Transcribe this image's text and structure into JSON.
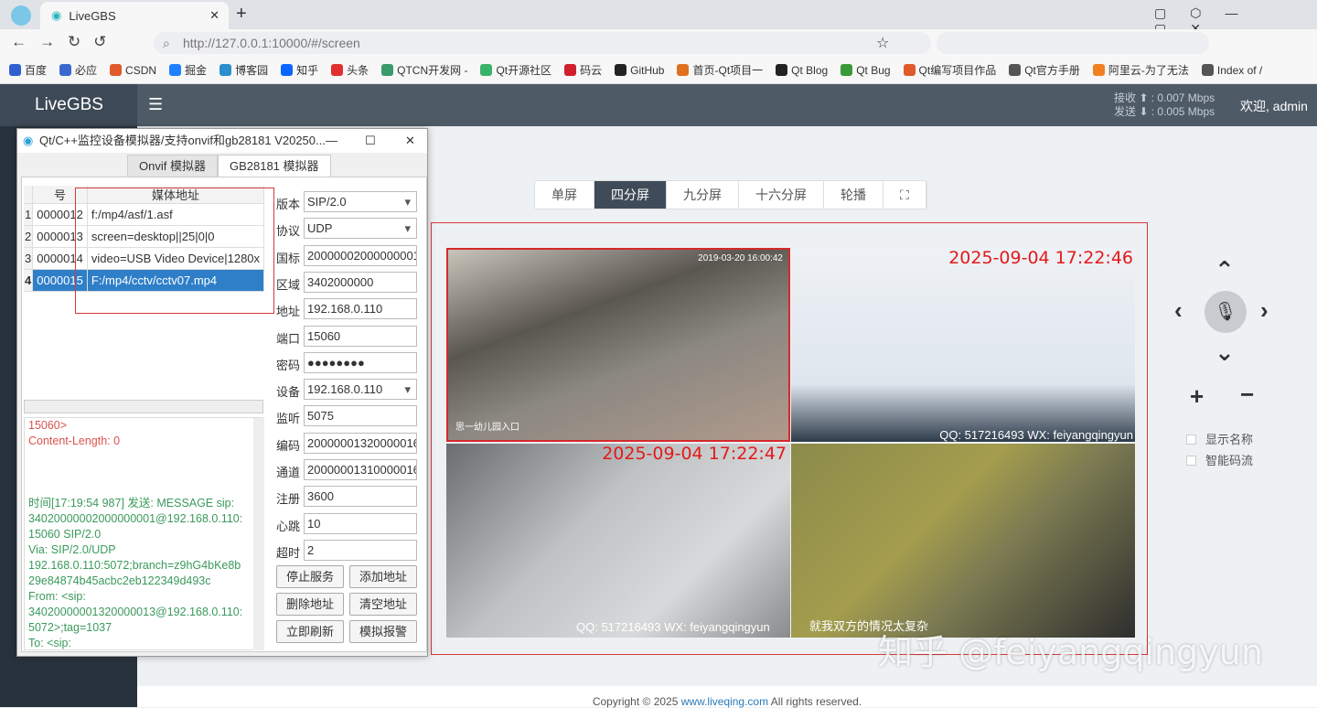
{
  "browser": {
    "tab_title": "LiveGBS",
    "url": "http://127.0.0.1:10000/#/screen",
    "bookmarks": [
      "百度",
      "必应",
      "CSDN",
      "掘金",
      "博客园",
      "知乎",
      "头条",
      "QTCN开发网 -",
      "Qt开源社区",
      "码云",
      "GitHub",
      "首页-Qt项目一",
      "Qt Blog",
      "Qt Bug",
      "Qt编写项目作品",
      "Qt官方手册",
      "阿里云-为了无法",
      "Index of /"
    ]
  },
  "app": {
    "logo": "LiveGBS",
    "recv_label": "接收",
    "recv_rate": "0.007 Mbps",
    "send_label": "发送",
    "send_rate": "0.005 Mbps",
    "welcome": "欢迎, admin",
    "layout_tabs": [
      "单屏",
      "四分屏",
      "九分屏",
      "十六分屏",
      "轮播"
    ],
    "active_layout": "四分屏",
    "tiles": [
      {
        "timestamp": "2019-03-20 16:00:42",
        "caption": "思一幼儿园入口"
      },
      {
        "timestamp": "2025-09-04 17:22:46",
        "qq": "QQ: 517216493  WX: feiyangqingyun"
      },
      {
        "timestamp": "2025-09-04 17:22:47"
      },
      {
        "qq": "QQ: 517216493  WX: feiyangqingyun",
        "subtitle": "就我双方的情况太复杂"
      }
    ],
    "options": [
      "显示名称",
      "智能码流"
    ],
    "watermark": "知乎 @feiyangqingyun",
    "footer": {
      "prefix": "Copyright © 2025 ",
      "link": "www.liveqing.com",
      "suffix": " All rights reserved."
    }
  },
  "qt": {
    "title": "Qt/C++监控设备模拟器/支持onvif和gb28181 V20250...",
    "tabs": [
      "Onvif 模拟器",
      "GB28181 模拟器"
    ],
    "table": {
      "headers": [
        "号",
        "媒体地址"
      ],
      "rows": [
        [
          "1",
          "0000012",
          "f:/mp4/asf/1.asf"
        ],
        [
          "2",
          "0000013",
          "screen=desktop||25|0|0"
        ],
        [
          "3",
          "0000014",
          "video=USB Video Device|1280x"
        ],
        [
          "4",
          "0000015",
          "F:/mp4/cctv/cctv07.mp4"
        ]
      ]
    },
    "log": [
      {
        "t": "15060>",
        "c": "#d9534f"
      },
      {
        "t": "Content-Length: 0",
        "c": "#d9534f"
      },
      {
        "t": "",
        "c": ""
      },
      {
        "t": "",
        "c": ""
      },
      {
        "t": "",
        "c": ""
      },
      {
        "t": "时间[17:19:54 987] 发送: MESSAGE sip:",
        "c": "#3a9a5b"
      },
      {
        "t": "34020000002000000001@192.168.0.110:",
        "c": "#3a9a5b"
      },
      {
        "t": "15060 SIP/2.0",
        "c": "#3a9a5b"
      },
      {
        "t": "Via: SIP/2.0/UDP",
        "c": "#3a9a5b"
      },
      {
        "t": "192.168.0.110:5072;branch=z9hG4bKe8b",
        "c": "#3a9a5b"
      },
      {
        "t": "29e84874b45acbc2eb122349d493c",
        "c": "#3a9a5b"
      },
      {
        "t": "From: <sip:",
        "c": "#3a9a5b"
      },
      {
        "t": "34020000001320000013@192.168.0.110:",
        "c": "#3a9a5b"
      },
      {
        "t": "5072>;tag=1037",
        "c": "#3a9a5b"
      },
      {
        "t": "To: <sip:",
        "c": "#3a9a5b"
      }
    ],
    "fields": [
      [
        "版本",
        "SIP/2.0"
      ],
      [
        "协议",
        "UDP"
      ],
      [
        "国标",
        "20000002000000001"
      ],
      [
        "区域",
        "3402000000"
      ],
      [
        "地址",
        "192.168.0.110"
      ],
      [
        "端口",
        "15060"
      ],
      [
        "密码",
        "●●●●●●●●"
      ],
      [
        "设备",
        "192.168.0.110"
      ],
      [
        "监听",
        "5075"
      ],
      [
        "编码",
        "20000001320000016"
      ],
      [
        "通道",
        "20000001310000016"
      ],
      [
        "注册",
        "3600"
      ],
      [
        "心跳",
        "10"
      ],
      [
        "超时",
        "2"
      ]
    ],
    "buttons": [
      "停止服务",
      "添加地址",
      "删除地址",
      "清空地址",
      "立即刷新",
      "模拟报警"
    ]
  }
}
